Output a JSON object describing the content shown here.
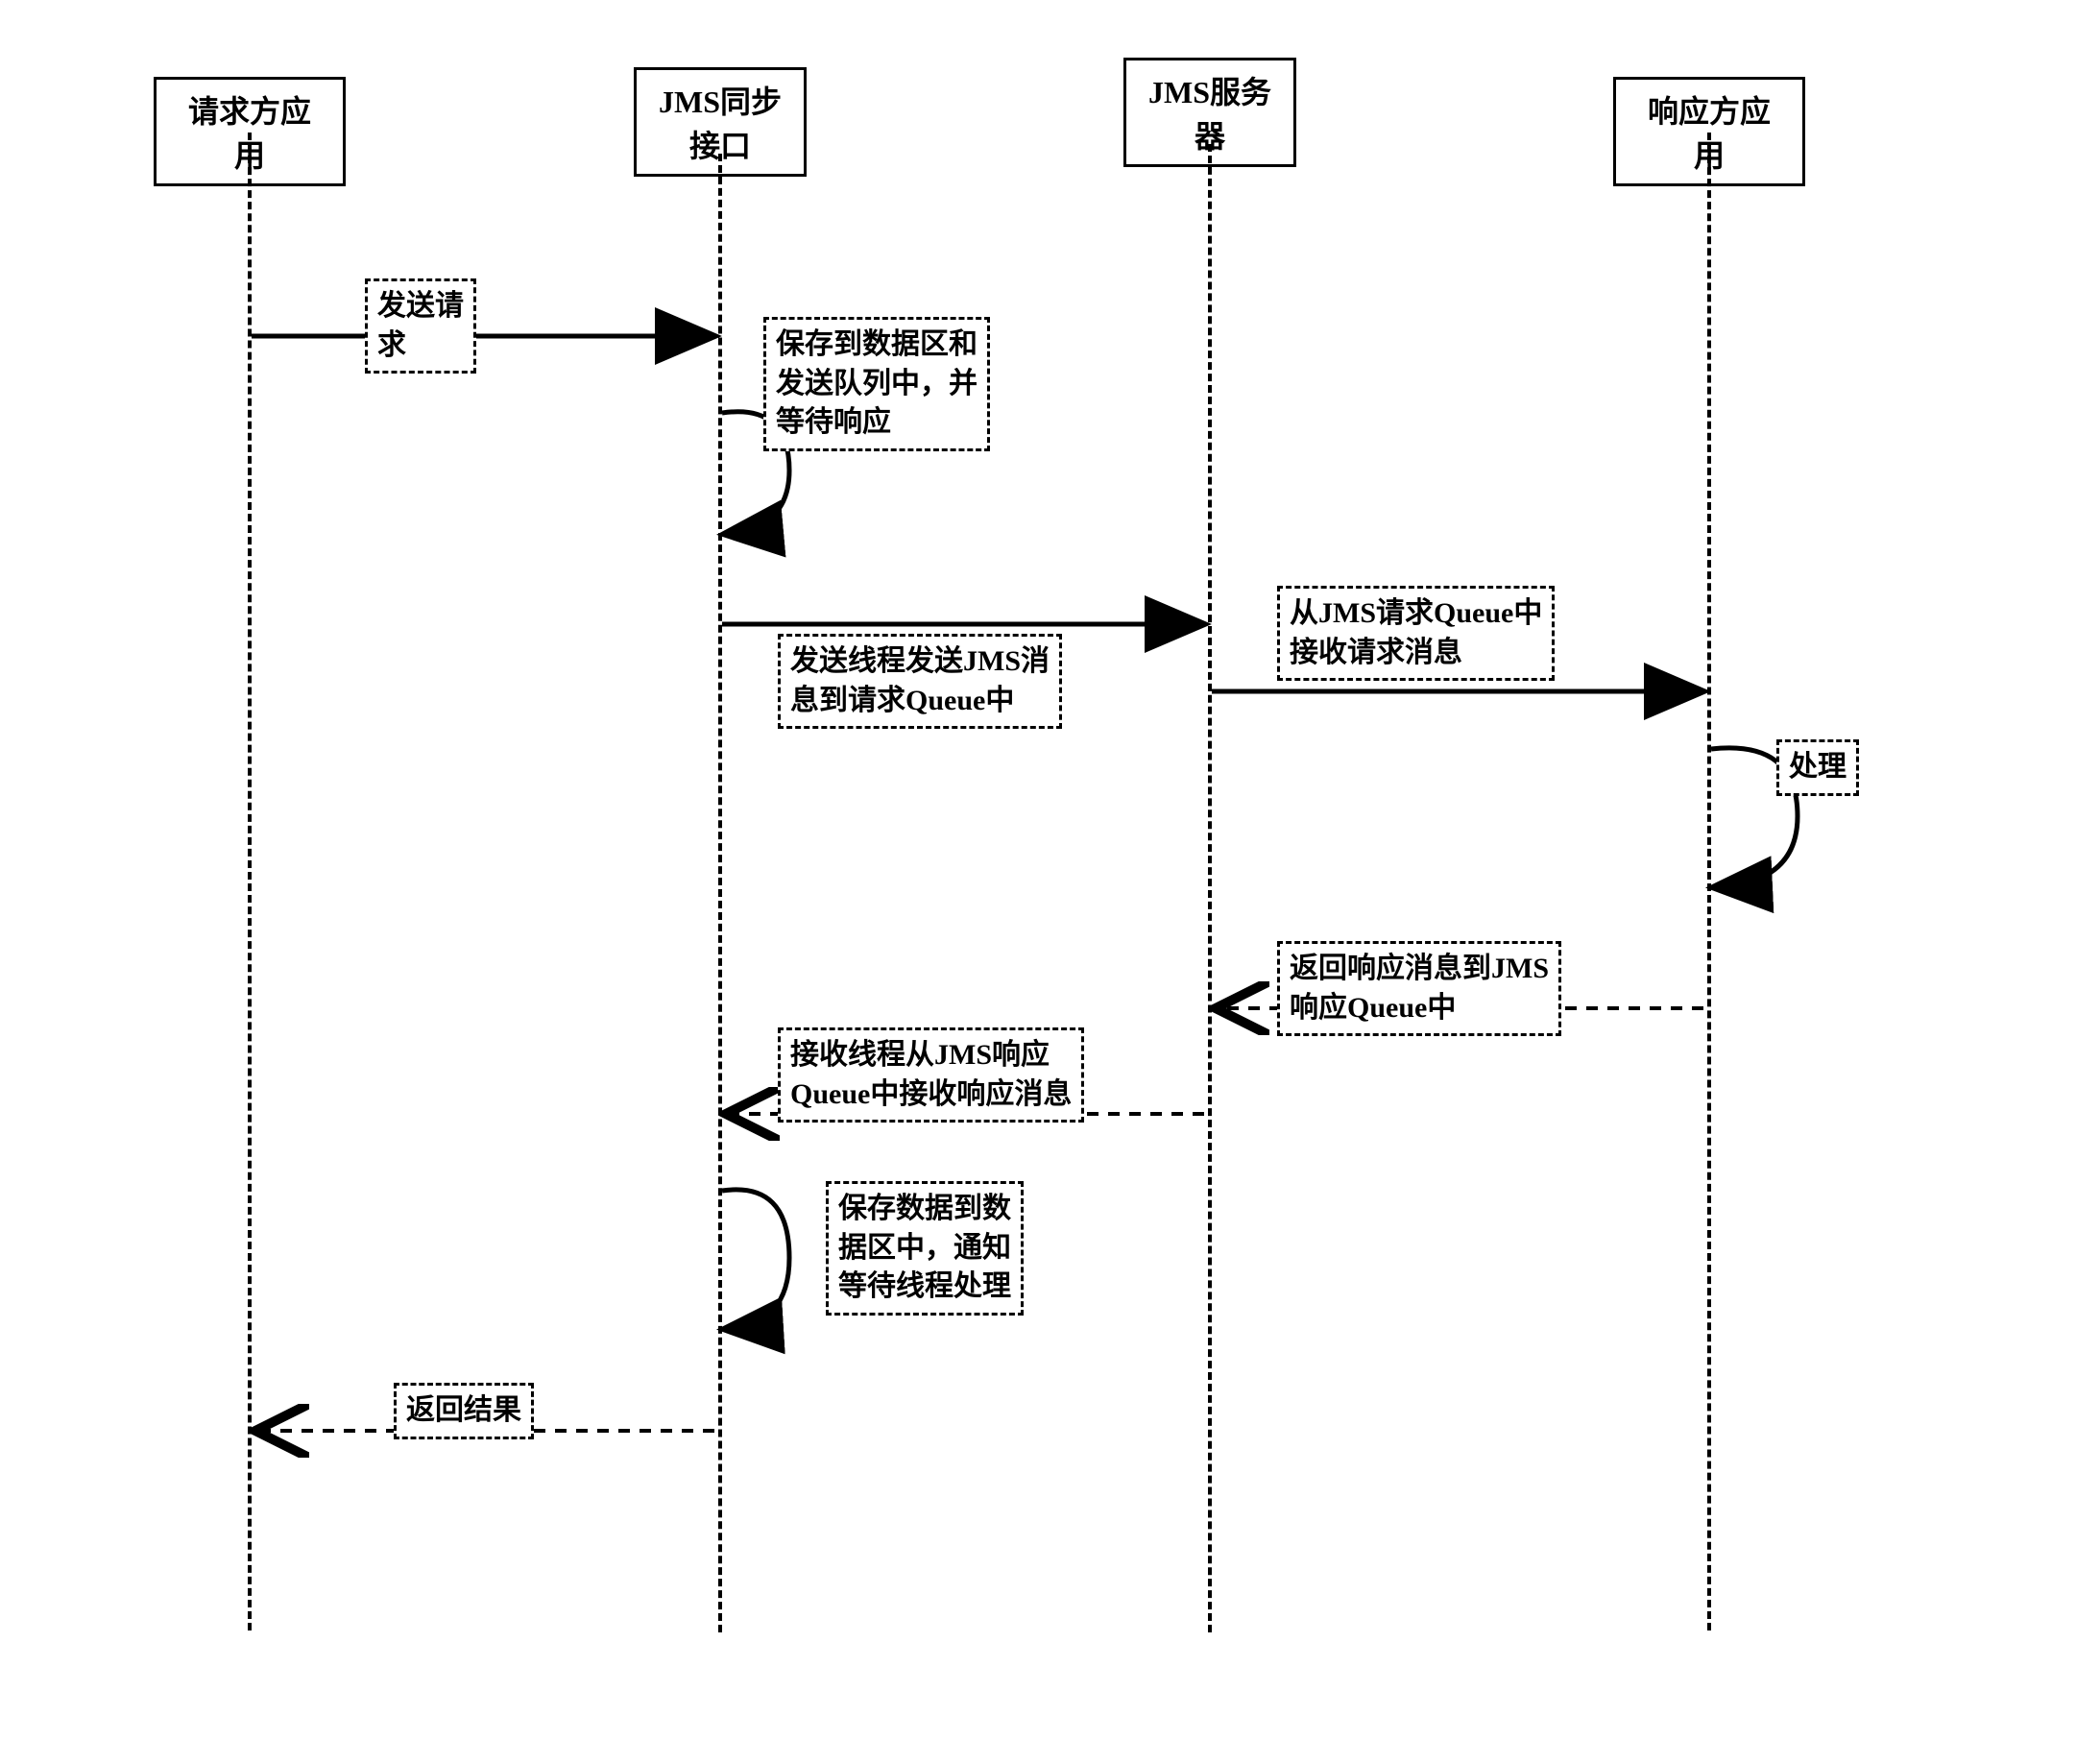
{
  "participants": {
    "requester": "请求方应用",
    "jmsSync": "JMS同步\n接口",
    "jmsServer": "JMS服务\n器",
    "responder": "响应方应用"
  },
  "messages": {
    "sendRequest": "发送请\n求",
    "saveAndWait": "保存到数据区和\n发送队列中，并\n等待响应",
    "sendThread": "发送线程发送JMS消\n息到请求Queue中",
    "recvFromQueue": "从JMS请求Queue中\n接收请求消息",
    "process": "处理",
    "returnResp": "返回响应消息到JMS\n响应Queue中",
    "recvThread": "接收线程从JMS响应\nQueue中接收响应消息",
    "saveNotify": "保存数据到数\n据区中，通知\n等待线程处理",
    "returnResult": "返回结果"
  }
}
